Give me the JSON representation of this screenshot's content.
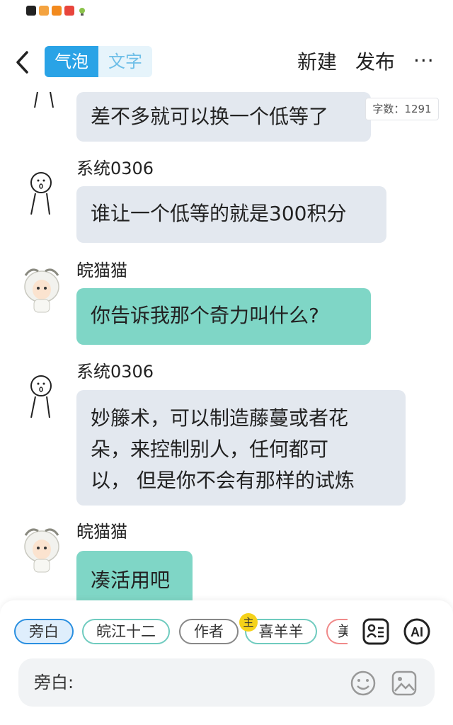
{
  "status": {
    "app_icons": [
      "cctv-app-icon",
      "orange-app-icon",
      "orange-app-icon",
      "red-app-icon",
      "lightbulb-icon"
    ]
  },
  "header": {
    "mode_bubble": "气泡",
    "mode_text": "文字",
    "new_label": "新建",
    "publish_label": "发布",
    "more_label": "···",
    "word_count": "字数：1291"
  },
  "messages": [
    {
      "name": "",
      "text": "差不多就可以换一个低等了",
      "style": "gray",
      "avatar": "stick-figure"
    },
    {
      "name": "系统0306",
      "text": "谁让一个低等的就是300积分",
      "style": "gray",
      "avatar": "stick-figure"
    },
    {
      "name": "皖猫猫",
      "text": "你告诉我那个奇力叫什么?",
      "style": "teal",
      "avatar": "sheep"
    },
    {
      "name": "系统0306",
      "lines": [
        "妙籐术，可以制造藤蔓或者花",
        "朵，来控制别人，任何都可",
        "以， 但是你不会有那样的试炼"
      ],
      "style": "gray",
      "avatar": "stick-figure"
    },
    {
      "name": "皖猫猫",
      "text": "凑活用吧",
      "style": "teal",
      "avatar": "sheep"
    }
  ],
  "roles": [
    {
      "label": "旁白",
      "selected": true
    },
    {
      "label": "皖江十二"
    },
    {
      "label": "作者"
    },
    {
      "label": "喜羊羊",
      "badge": "主"
    },
    {
      "label": "美"
    }
  ],
  "composer": {
    "label": "旁白:"
  },
  "colors": {
    "accent": "#2aa3e6",
    "teal_bubble": "#7fd6c6",
    "gray_bubble": "#e3e8ef"
  }
}
